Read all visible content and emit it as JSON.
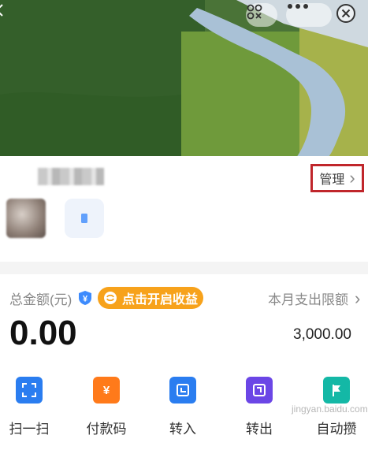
{
  "header": {
    "icons": [
      "back-icon",
      "scan-icon",
      "more-icon",
      "close-icon"
    ]
  },
  "account": {
    "manage_label": "管理",
    "manage_chevron": "›"
  },
  "balance": {
    "total_label": "总金额(元)",
    "earn_button": "点击开启收益",
    "amount": "0.00",
    "limit_label": "本月支出限额",
    "limit_chevron": "›",
    "limit_value": "3,000.00"
  },
  "actions": [
    {
      "label": "扫一扫",
      "icon": "scan-frame-icon",
      "color": "#2a7df0"
    },
    {
      "label": "付款码",
      "icon": "yuan-icon",
      "color": "#ff7a1a"
    },
    {
      "label": "转入",
      "icon": "transfer-in-icon",
      "color": "#2a7df0"
    },
    {
      "label": "转出",
      "icon": "transfer-out-icon",
      "color": "#6b46e6"
    },
    {
      "label": "自动攒",
      "icon": "flag-icon",
      "color": "#14b8a6"
    }
  ],
  "watermark": "jingyan.baidu.com",
  "colors": {
    "accent_orange": "#f7a21b",
    "highlight_red": "#c0262b",
    "shield_blue": "#3d8bfd"
  }
}
